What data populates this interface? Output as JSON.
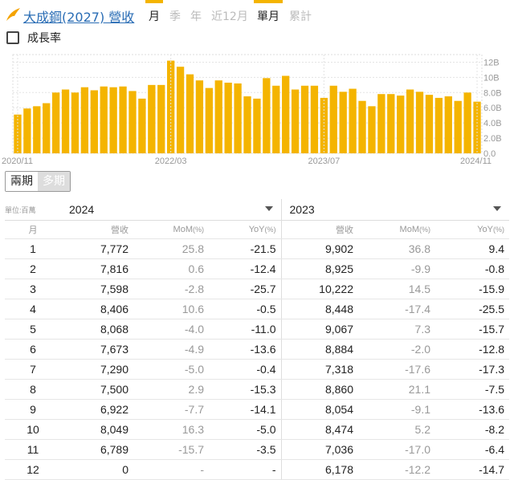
{
  "header": {
    "title": "大成鋼(2027) 營收",
    "period_tabs": [
      {
        "label": "月",
        "active": true
      },
      {
        "label": "季",
        "active": false
      },
      {
        "label": "年",
        "active": false
      },
      {
        "label": "近12月",
        "active": false
      },
      {
        "label": "單月",
        "active": true
      },
      {
        "label": "累計",
        "active": false
      }
    ]
  },
  "growth_toggle": {
    "label": "成長率",
    "checked": false
  },
  "chart_data": {
    "type": "bar",
    "y_ticks": [
      "12B",
      "10B",
      "8.0B",
      "6.0B",
      "4.0B",
      "2.0B",
      "0.0"
    ],
    "ylim": [
      0,
      13000
    ],
    "x_tick_labels": [
      "2020/11",
      "2022/03",
      "2023/07",
      "2024/11"
    ],
    "x_tick_index": [
      0,
      16,
      32,
      48
    ],
    "color": "#f4b400",
    "values": [
      5100,
      5900,
      6200,
      6600,
      8000,
      8400,
      8000,
      8700,
      8300,
      8800,
      8700,
      8800,
      8200,
      7200,
      9000,
      9000,
      12200,
      11400,
      10400,
      9600,
      8600,
      9600,
      9300,
      9200,
      7500,
      7200,
      9900,
      8900,
      10200,
      8400,
      8900,
      8900,
      7300,
      8900,
      8100,
      8500,
      6900,
      6200,
      7800,
      7800,
      7600,
      8400,
      8100,
      7700,
      7300,
      7500,
      6900,
      8000,
      6800
    ],
    "series_months": "2020/11 - 2024/11"
  },
  "view_toggle": {
    "options": [
      "兩期",
      "多期"
    ],
    "active": "兩期"
  },
  "table": {
    "unit_label": "單位:百萬",
    "year_left": "2024",
    "year_right": "2023",
    "col_headers": {
      "month": "月",
      "revenue": "營收",
      "mom": "MoM",
      "yoy": "YoY",
      "pct": "(%)"
    },
    "rows": [
      {
        "m": "1",
        "r24": "7,772",
        "mom24": "25.8",
        "yoy24": "-21.5",
        "r23": "9,902",
        "mom23": "36.8",
        "yoy23": "9.4"
      },
      {
        "m": "2",
        "r24": "7,816",
        "mom24": "0.6",
        "yoy24": "-12.4",
        "r23": "8,925",
        "mom23": "-9.9",
        "yoy23": "-0.8"
      },
      {
        "m": "3",
        "r24": "7,598",
        "mom24": "-2.8",
        "yoy24": "-25.7",
        "r23": "10,222",
        "mom23": "14.5",
        "yoy23": "-15.9"
      },
      {
        "m": "4",
        "r24": "8,406",
        "mom24": "10.6",
        "yoy24": "-0.5",
        "r23": "8,448",
        "mom23": "-17.4",
        "yoy23": "-25.5"
      },
      {
        "m": "5",
        "r24": "8,068",
        "mom24": "-4.0",
        "yoy24": "-11.0",
        "r23": "9,067",
        "mom23": "7.3",
        "yoy23": "-15.7"
      },
      {
        "m": "6",
        "r24": "7,673",
        "mom24": "-4.9",
        "yoy24": "-13.6",
        "r23": "8,884",
        "mom23": "-2.0",
        "yoy23": "-12.8"
      },
      {
        "m": "7",
        "r24": "7,290",
        "mom24": "-5.0",
        "yoy24": "-0.4",
        "r23": "7,318",
        "mom23": "-17.6",
        "yoy23": "-17.3"
      },
      {
        "m": "8",
        "r24": "7,500",
        "mom24": "2.9",
        "yoy24": "-15.3",
        "r23": "8,860",
        "mom23": "21.1",
        "yoy23": "-7.5"
      },
      {
        "m": "9",
        "r24": "6,922",
        "mom24": "-7.7",
        "yoy24": "-14.1",
        "r23": "8,054",
        "mom23": "-9.1",
        "yoy23": "-13.6"
      },
      {
        "m": "10",
        "r24": "8,049",
        "mom24": "16.3",
        "yoy24": "-5.0",
        "r23": "8,474",
        "mom23": "5.2",
        "yoy23": "-8.2"
      },
      {
        "m": "11",
        "r24": "6,789",
        "mom24": "-15.7",
        "yoy24": "-3.5",
        "r23": "7,036",
        "mom23": "-17.0",
        "yoy23": "-6.4"
      },
      {
        "m": "12",
        "r24": "0",
        "mom24": "-",
        "yoy24": "-",
        "r23": "6,178",
        "mom23": "-12.2",
        "yoy23": "-14.7"
      }
    ]
  }
}
